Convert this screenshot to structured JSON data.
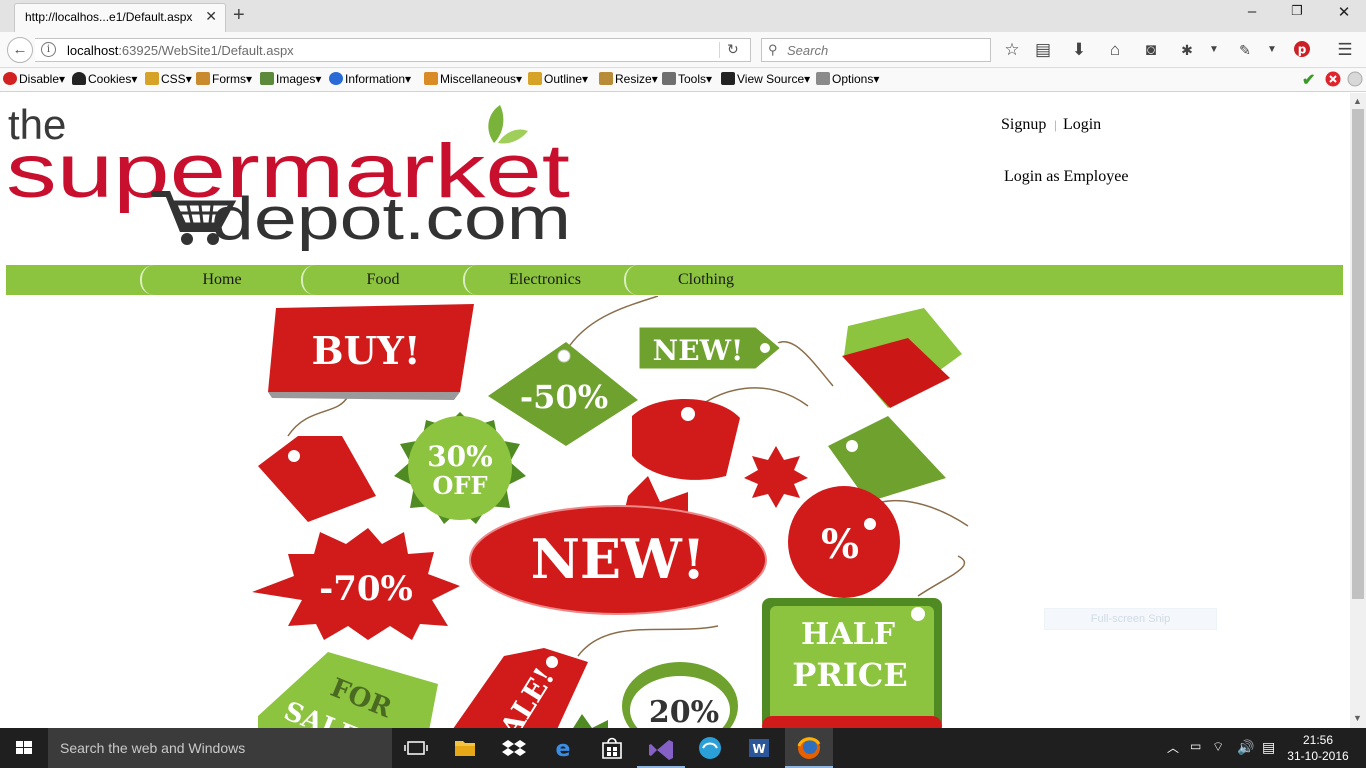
{
  "browser": {
    "tab_title": "http://localhos...e1/Default.aspx",
    "url_host": "localhost",
    "url_path": ":63925/WebSite1/Default.aspx",
    "search_placeholder": "Search"
  },
  "dev_toolbar": {
    "items": [
      "Disable",
      "Cookies",
      "CSS",
      "Forms",
      "Images",
      "Information",
      "Miscellaneous",
      "Outline",
      "Resize",
      "Tools",
      "View Source",
      "Options"
    ]
  },
  "page": {
    "logo": {
      "line1": "the",
      "line2": "supermarket",
      "line3": "depot.com"
    },
    "links": {
      "signup": "Signup",
      "separator": "|",
      "login": "Login",
      "employee_login": "Login as Employee"
    },
    "menu": [
      "Home",
      "Food",
      "Electronics",
      "Clothing"
    ],
    "banner_tags": {
      "buy": "BUY!",
      "minus50": "-50%",
      "new_small": "NEW!",
      "off30_a": "30%",
      "off30_b": "OFF",
      "minus70": "-70%",
      "new_big": "NEW!",
      "percent": "%",
      "half_a": "HALF",
      "half_b": "PRICE",
      "for_sale_a": "FOR",
      "for_sale_b": "SALE",
      "sale": "SALE!",
      "twenty": "20%"
    },
    "overlay_text": "Full-screen Snip"
  },
  "taskbar": {
    "search_text": "Search the web and Windows",
    "time": "21:56",
    "date": "31-10-2016"
  },
  "colors": {
    "menu_green": "#8cc43f",
    "logo_red": "#c8102e",
    "logo_dark": "#3a3a3a",
    "taskbar": "#1f1f1f"
  }
}
